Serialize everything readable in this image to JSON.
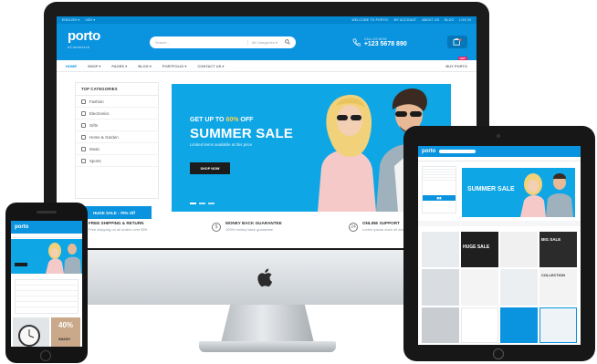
{
  "desktop": {
    "topbar": {
      "language": "ENGLISH ▾",
      "currency": "USD ▾",
      "links": [
        "WELCOME TO PORTO!",
        "MY ACCOUNT",
        "ABOUT US",
        "BLOG",
        "LOG IN"
      ]
    },
    "header": {
      "logo": "porto",
      "logo_sub": "eCommerce",
      "search_placeholder": "Search...",
      "search_category": "All Categories ▾",
      "call_label": "CALL US NOW",
      "phone": "+123 5678 890"
    },
    "nav": {
      "items": [
        "HOME",
        "SHOP ▾",
        "PAGES ▾",
        "BLOG ▾",
        "PORTFOLIO ▾",
        "CONTACT US ▾"
      ],
      "buy": "BUY PORTO",
      "badge": "HOT"
    },
    "categories": {
      "title": "TOP CATEGORIES",
      "items": [
        "Fashion",
        "Electronics",
        "Gifts",
        "Home & Garden",
        "Music",
        "Sports"
      ],
      "huge_sale": "HUGE SALE - 70% Off"
    },
    "banner": {
      "kicker_prefix": "GET UP TO",
      "kicker_percent": "60%",
      "kicker_suffix": "OFF",
      "headline": "SUMMER SALE",
      "subtitle": "Limited items available at this price",
      "button": "SHOP NOW"
    },
    "features": [
      {
        "title": "FREE SHIPPING & RETURN",
        "text": "Free shipping on all orders over $99."
      },
      {
        "title": "MONEY BACK GUARANTEE",
        "text": "100% money back guarantee"
      },
      {
        "title": "ONLINE SUPPORT",
        "text": "Lorem ipsum dolor sit amet."
      }
    ]
  },
  "tablet": {
    "logo": "porto",
    "banner_headline": "SUMMER SALE",
    "huge_sale": "HUGE SALE",
    "big_sale": "BIG SALE",
    "collection": "COLLECTION"
  },
  "phone": {
    "logo": "porto",
    "promo": "40%",
    "promo_label": "SMASH"
  },
  "colors": {
    "primary": "#0a93df",
    "topbar": "#0187cf",
    "banner": "#0fa6e6",
    "accent": "#ffd24d",
    "badge": "#e91e63"
  }
}
